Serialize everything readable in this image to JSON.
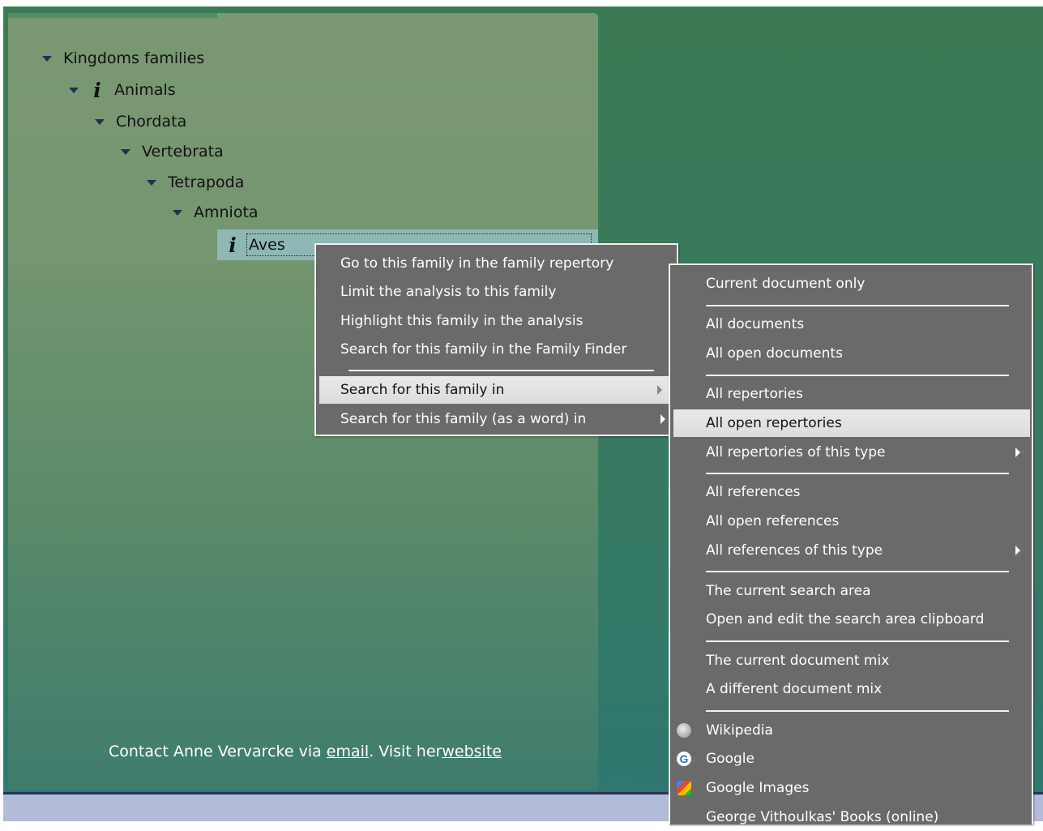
{
  "tree": {
    "root": "Kingdoms families",
    "animals": "Animals",
    "chordata": "Chordata",
    "vertebrata": "Vertebrata",
    "tetrapoda": "Tetrapoda",
    "amniota": "Amniota",
    "aves": "Aves"
  },
  "footer": {
    "prefix": "Contact Anne Vervarcke via ",
    "email_link": "email",
    "middle": ". Visit her",
    "website_link": "website"
  },
  "context_menu": {
    "items": [
      "Go to this family in the family repertory",
      "Limit the analysis to this family",
      "Highlight this family in the analysis",
      "Search for this family in the Family Finder",
      "Search for this family in",
      "Search for this family (as a word) in"
    ],
    "highlighted_index": 4
  },
  "submenu": {
    "items": [
      "Current document only",
      "All documents",
      "All open documents",
      "All repertories",
      "All open repertories",
      "All repertories of this type",
      "All references",
      "All open references",
      "All references of this type",
      "The current search area",
      "Open and edit the search area clipboard",
      "The current document mix",
      "A different document mix",
      "Wikipedia",
      "Google",
      "Google Images",
      "George Vithoulkas' Books (online)"
    ],
    "highlighted_index": 4,
    "icons": {
      "wikipedia": "wikipedia-globe-icon",
      "google": "google-g-icon",
      "google_images": "google-images-icon"
    }
  },
  "colors": {
    "menu_bg": "#6a6a6a",
    "highlight": "#e3e3e3",
    "selection": "#8fb7b6"
  }
}
